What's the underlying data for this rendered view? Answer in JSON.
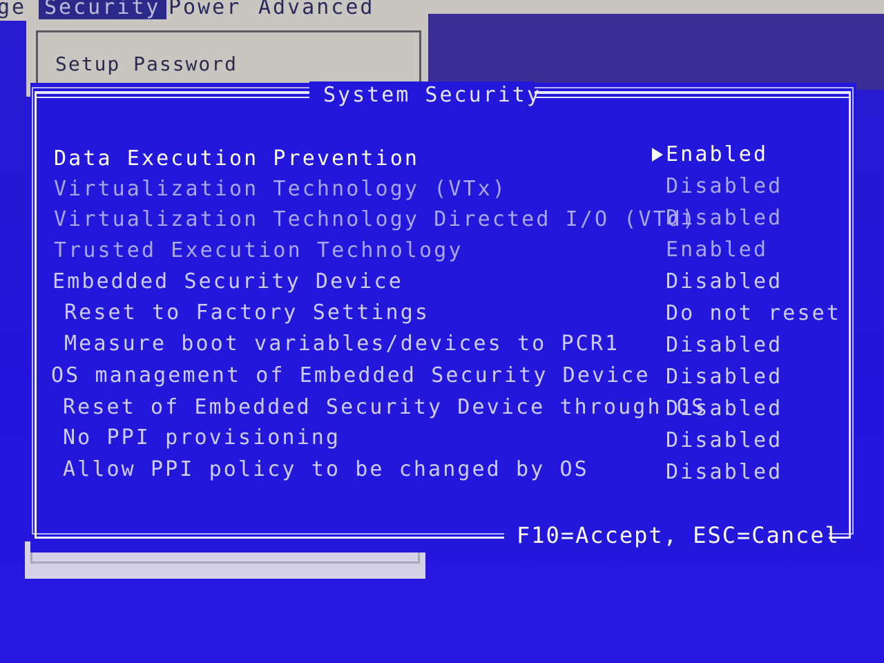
{
  "menubar": {
    "items": [
      {
        "label": "ge"
      },
      {
        "label": "Security"
      },
      {
        "label": "Power"
      },
      {
        "label": "Advanced"
      }
    ]
  },
  "background_panel": {
    "setup_password_label": "Setup Password"
  },
  "dialog": {
    "title": "System Security",
    "footer": "F10=Accept, ESC=Cancel",
    "rows": [
      {
        "label": "Data Execution Prevention",
        "value": "Enabled",
        "state": "selected"
      },
      {
        "label": "Virtualization Technology (VTx)",
        "value": "Disabled",
        "state": "dim"
      },
      {
        "label": "Virtualization Technology Directed I/O (VTd)",
        "value": "Disabled",
        "state": "dim"
      },
      {
        "label": "Trusted Execution Technology",
        "value": "Enabled",
        "state": "dim"
      },
      {
        "label": "Embedded Security Device",
        "value": "Disabled",
        "state": "normal"
      },
      {
        "label": "Reset to Factory Settings",
        "value": "Do not reset",
        "state": "normal"
      },
      {
        "label": "Measure boot variables/devices to PCR1",
        "value": "Disabled",
        "state": "normal"
      },
      {
        "label": "OS management of Embedded Security Device",
        "value": "Disabled",
        "state": "normal"
      },
      {
        "label": "Reset of Embedded Security Device through OS",
        "value": "Disabled",
        "state": "normal"
      },
      {
        "label": "No PPI provisioning",
        "value": "Disabled",
        "state": "normal"
      },
      {
        "label": "Allow PPI policy to be changed by OS",
        "value": "Disabled",
        "state": "normal"
      }
    ]
  },
  "colors": {
    "dialog_background": "#2317dc",
    "menubar_background": "#c9c6c2",
    "selected_text": "#ffffff",
    "dim_text": "#aaa6f2"
  }
}
